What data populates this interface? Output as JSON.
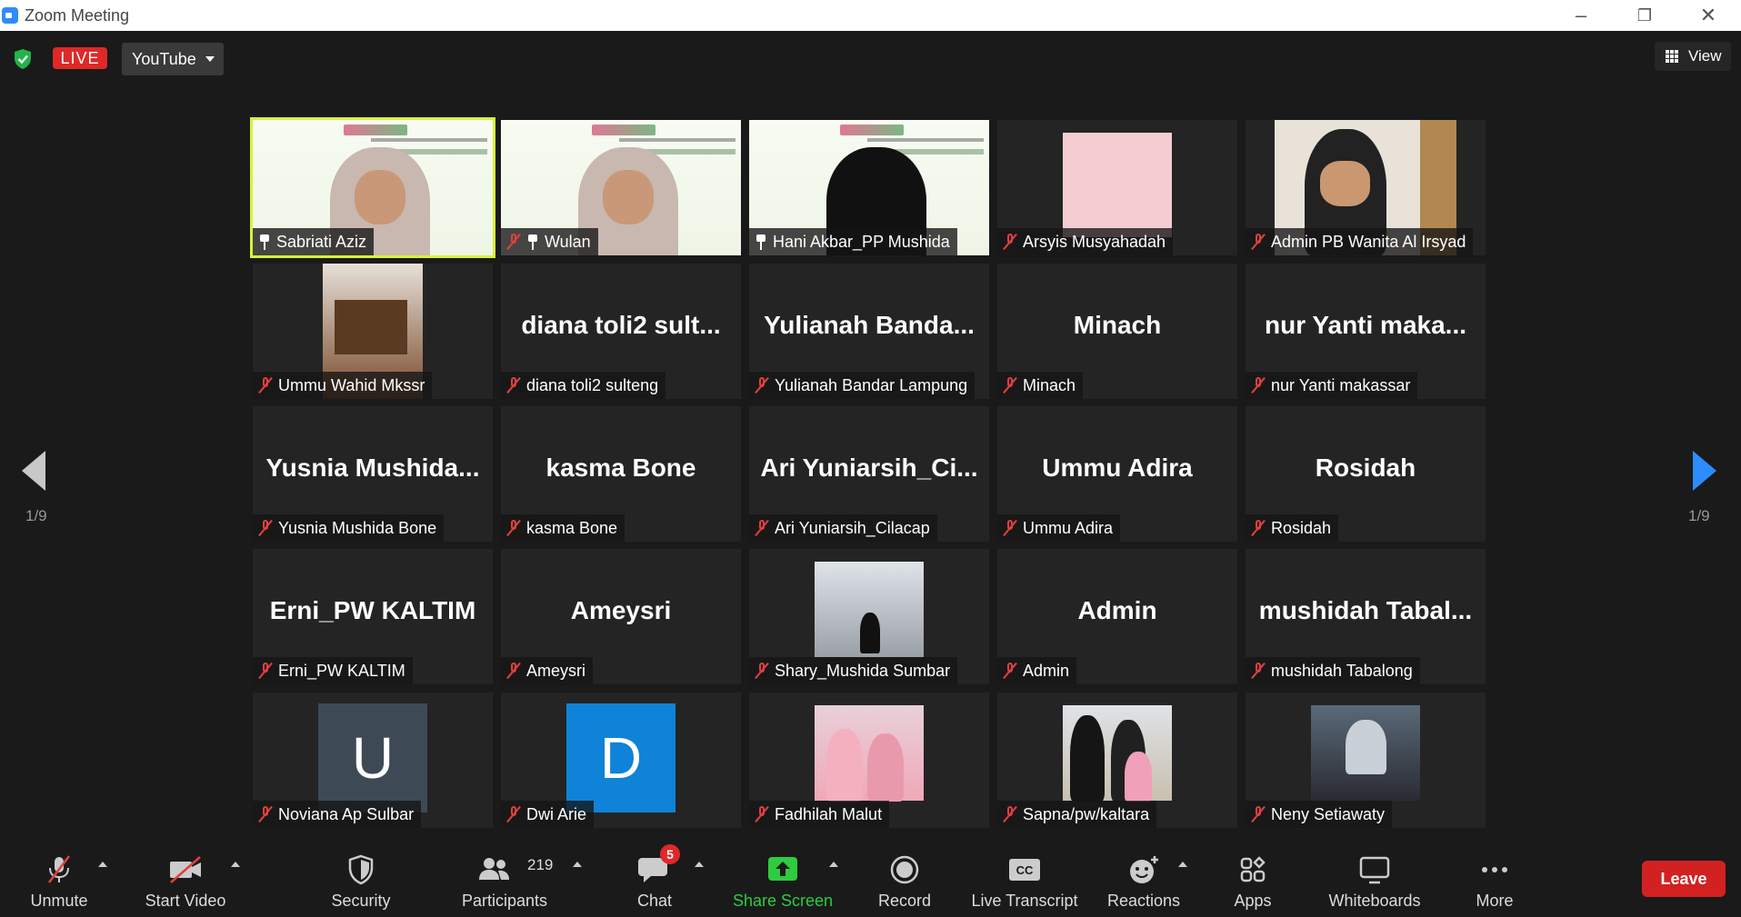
{
  "window": {
    "title": "Zoom Meeting"
  },
  "topbar": {
    "live_label": "LIVE",
    "stream_target": "YouTube",
    "view_label": "View"
  },
  "pagination": {
    "left": "1/9",
    "right": "1/9"
  },
  "tiles": [
    {
      "name": "Sabriati Aziz",
      "kind": "slide",
      "pinned": true,
      "muted": false,
      "active": true
    },
    {
      "name": "Wulan",
      "kind": "slide",
      "pinned": true,
      "muted": true
    },
    {
      "name": "Hani Akbar_PP Mushida",
      "kind": "slide",
      "pinned": true,
      "muted": false
    },
    {
      "name": "Arsyis Musyahadah",
      "kind": "photo",
      "muted": true
    },
    {
      "name": "Admin PB Wanita Al Irsyad",
      "kind": "photo",
      "muted": true
    },
    {
      "name": "Ummu Wahid Mkssr",
      "kind": "photo",
      "muted": true
    },
    {
      "name": "diana toli2 sulteng",
      "big": "diana toli2 sult...",
      "kind": "text",
      "muted": true
    },
    {
      "name": "Yulianah Bandar Lampung",
      "big": "Yulianah  Banda...",
      "kind": "text",
      "muted": true
    },
    {
      "name": "Minach",
      "big": "Minach",
      "kind": "text",
      "muted": true
    },
    {
      "name": "nur  Yanti makassar",
      "big": "nur  Yanti maka...",
      "kind": "text",
      "muted": true
    },
    {
      "name": "Yusnia Mushida Bone",
      "big": "Yusnia  Mushida...",
      "kind": "text",
      "muted": true
    },
    {
      "name": "kasma Bone",
      "big": "kasma Bone",
      "kind": "text",
      "muted": true
    },
    {
      "name": "Ari Yuniarsih_Cilacap",
      "big": "Ari  Yuniarsih_Ci...",
      "kind": "text",
      "muted": true
    },
    {
      "name": "Ummu Adira",
      "big": "Ummu Adira",
      "kind": "text",
      "muted": true
    },
    {
      "name": "Rosidah",
      "big": "Rosidah",
      "kind": "text",
      "muted": true
    },
    {
      "name": "Erni_PW KALTIM",
      "big": "Erni_PW KALTIM",
      "kind": "text",
      "muted": true
    },
    {
      "name": "Ameysri",
      "big": "Ameysri",
      "kind": "text",
      "muted": true
    },
    {
      "name": "Shary_Mushida Sumbar",
      "kind": "photo",
      "muted": true
    },
    {
      "name": "Admin",
      "big": "Admin",
      "kind": "text",
      "muted": true
    },
    {
      "name": "mushidah Tabalong",
      "big": "mushidah  Tabal...",
      "kind": "text",
      "muted": true
    },
    {
      "name": "Noviana Ap Sulbar",
      "kind": "avatar",
      "letter": "U",
      "color": "#3d4a55",
      "muted": true
    },
    {
      "name": "Dwi Arie",
      "kind": "avatar",
      "letter": "D",
      "color": "#0e83d8",
      "muted": true
    },
    {
      "name": "Fadhilah Malut",
      "kind": "photo",
      "muted": true
    },
    {
      "name": "Sapna/pw/kaltara",
      "kind": "photo",
      "muted": true
    },
    {
      "name": "Neny Setiawaty",
      "kind": "photo",
      "muted": true
    }
  ],
  "toolbar": {
    "unmute": "Unmute",
    "start_video": "Start Video",
    "security": "Security",
    "participants": "Participants",
    "participants_count": "219",
    "chat": "Chat",
    "chat_badge": "5",
    "share_screen": "Share Screen",
    "record": "Record",
    "live_transcript": "Live Transcript",
    "reactions": "Reactions",
    "apps": "Apps",
    "whiteboards": "Whiteboards",
    "more": "More",
    "leave": "Leave"
  },
  "colors": {
    "active_speaker": "#d8f23a",
    "share_green": "#2ecc40",
    "leave_red": "#d32121",
    "accent_blue": "#2d8cff"
  }
}
